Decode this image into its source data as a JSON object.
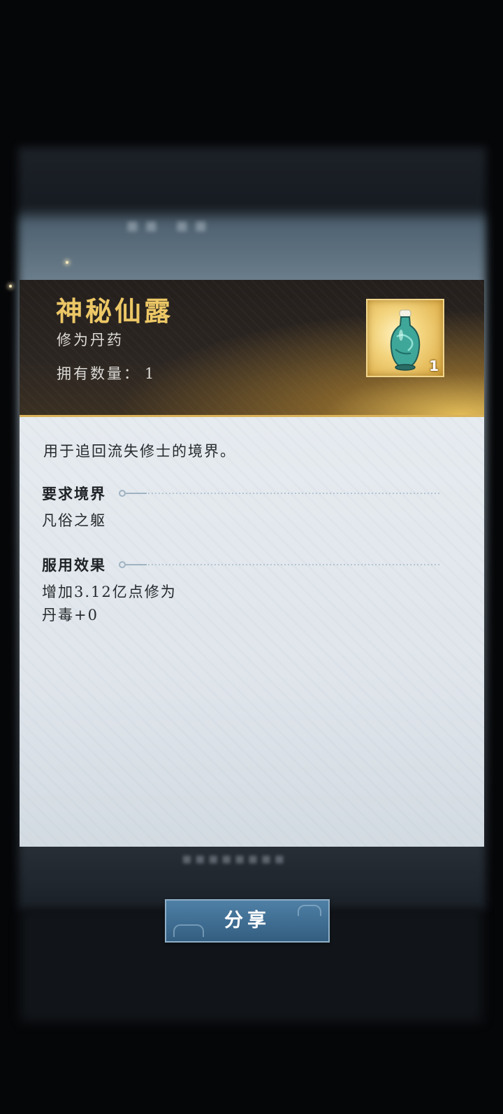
{
  "item": {
    "name": "神秘仙露",
    "type": "修为丹药",
    "owned_label": "拥有数量：",
    "owned_value": "1",
    "icon_name": "potion-bottle-icon",
    "icon_count": "1"
  },
  "description": "用于追回流失修士的境界。",
  "sections": {
    "requirement": {
      "title": "要求境界",
      "lines": [
        "凡俗之躯"
      ]
    },
    "effect": {
      "title": "服用效果",
      "lines": [
        "增加3.12亿点修为",
        "丹毒+0"
      ]
    }
  },
  "share_button": {
    "label": "分享"
  },
  "colors": {
    "title_gold": "#ecc766",
    "header_dark": "#241f1c",
    "button_blue": "#3f6d92",
    "body_bg": "#e6ebf0"
  }
}
